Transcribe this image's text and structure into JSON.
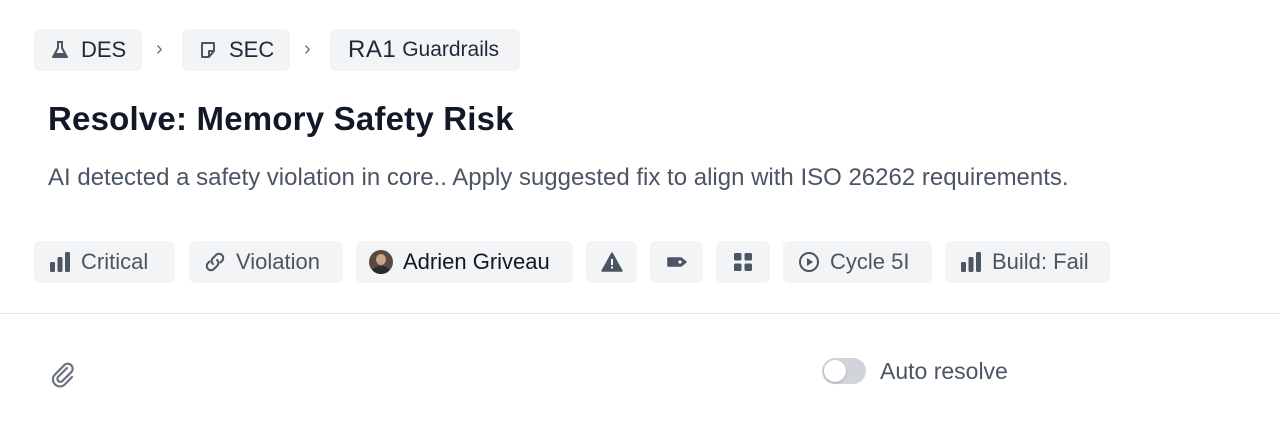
{
  "breadcrumb": {
    "items": [
      {
        "label": "DES",
        "icon": "flask-icon"
      },
      {
        "label": "SEC",
        "icon": "sticky-note-icon"
      },
      {
        "prefix": "RA1",
        "label": "Guardrails"
      }
    ],
    "separator": "›"
  },
  "title": "Resolve: Memory Safety Risk",
  "description": "AI detected a safety violation in core.. Apply suggested fix to align with ISO 26262 requirements.",
  "properties": {
    "priority": "Critical",
    "relation": "Violation",
    "assignee": "Adrien Griveau",
    "cycle": "Cycle 5I",
    "build": "Build: Fail"
  },
  "footer": {
    "auto_resolve_label": "Auto resolve",
    "auto_resolve_on": false
  },
  "colors": {
    "chip_bg": "#f3f4f6",
    "icon": "#4b5563",
    "title": "#111827"
  }
}
